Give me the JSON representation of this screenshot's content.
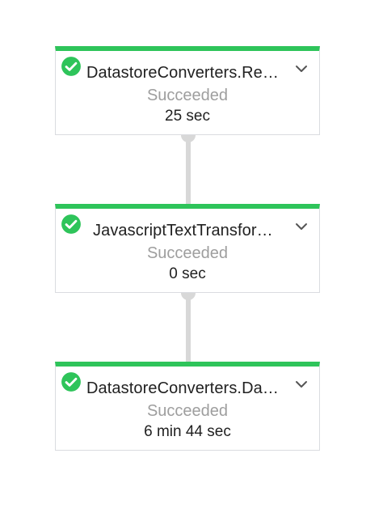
{
  "steps": [
    {
      "title": "DatastoreConverters.Re…",
      "status": "Succeeded",
      "duration": "25 sec",
      "status_icon": "check-circle-icon",
      "expand_icon": "chevron-down-icon"
    },
    {
      "title": "JavascriptTextTransfor…",
      "status": "Succeeded",
      "duration": "0 sec",
      "status_icon": "check-circle-icon",
      "expand_icon": "chevron-down-icon"
    },
    {
      "title": "DatastoreConverters.Da…",
      "status": "Succeeded",
      "duration": "6 min 44 sec",
      "status_icon": "check-circle-icon",
      "expand_icon": "chevron-down-icon"
    }
  ],
  "colors": {
    "success": "#2ec45a",
    "connector": "#d8d8d8",
    "status_text": "#9e9e9e",
    "title_text": "#212121"
  }
}
